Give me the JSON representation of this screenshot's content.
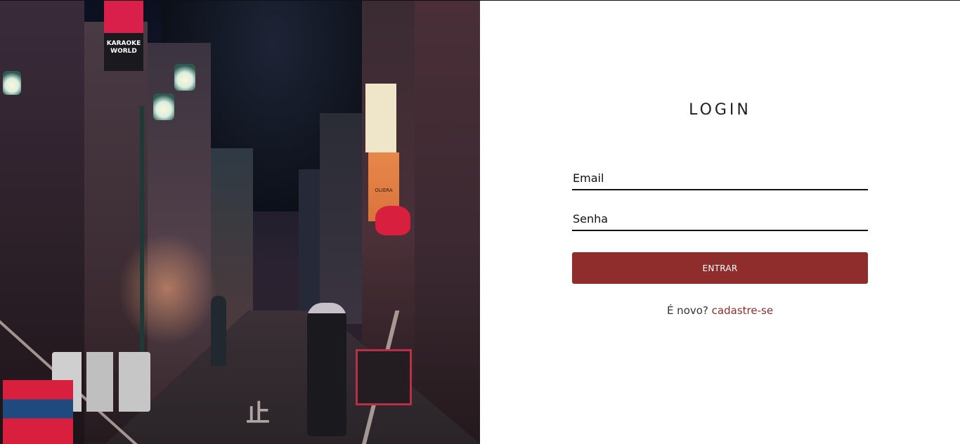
{
  "hero": {
    "signs": {
      "karaoke": "KARAOKE WORLD",
      "restaurant": "OLIERA"
    },
    "road_marking": "止"
  },
  "login": {
    "title": "LOGIN",
    "email_placeholder": "Email",
    "password_placeholder": "Senha",
    "submit_label": "ENTRAR",
    "signup_prompt": "É novo?",
    "signup_link": "cadastre-se"
  },
  "colors": {
    "accent": "#8e2d2b",
    "text": "#1f1f1f",
    "background": "#ffffff"
  }
}
